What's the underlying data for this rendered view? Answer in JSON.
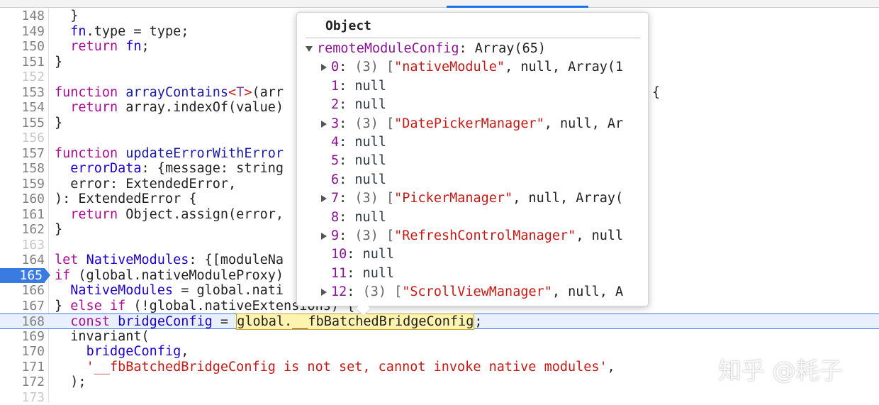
{
  "lines": [
    {
      "n": "148",
      "parts": [
        [
          "p",
          "  }"
        ]
      ]
    },
    {
      "n": "149",
      "parts": [
        [
          "p",
          "  "
        ],
        [
          "fn",
          "fn"
        ],
        [
          "p",
          ".type = type;"
        ]
      ]
    },
    {
      "n": "150",
      "parts": [
        [
          "p",
          "  "
        ],
        [
          "kw",
          "return"
        ],
        [
          "p",
          " "
        ],
        [
          "fn",
          "fn"
        ],
        [
          "p",
          ";"
        ]
      ]
    },
    {
      "n": "151",
      "parts": [
        [
          "p",
          "}"
        ]
      ]
    },
    {
      "n": "152",
      "dim": true,
      "parts": []
    },
    {
      "n": "153",
      "parts": [
        [
          "kw",
          "function"
        ],
        [
          "p",
          " "
        ],
        [
          "fn2",
          "arrayContains"
        ],
        [
          "str",
          "<"
        ],
        [
          "ty",
          "T"
        ],
        [
          "str",
          ">"
        ],
        [
          "p",
          "(arr"
        ]
      ],
      "tail": "{"
    },
    {
      "n": "154",
      "parts": [
        [
          "p",
          "  "
        ],
        [
          "kw",
          "return"
        ],
        [
          "p",
          " array.indexOf(value)"
        ]
      ]
    },
    {
      "n": "155",
      "parts": [
        [
          "p",
          "}"
        ]
      ]
    },
    {
      "n": "156",
      "dim": true,
      "parts": []
    },
    {
      "n": "157",
      "parts": [
        [
          "kw",
          "function"
        ],
        [
          "p",
          " "
        ],
        [
          "fn2",
          "updateErrorWithError"
        ]
      ]
    },
    {
      "n": "158",
      "parts": [
        [
          "p",
          "  "
        ],
        [
          "fn",
          "errorData"
        ],
        [
          "p",
          ": {message: string"
        ]
      ]
    },
    {
      "n": "159",
      "parts": [
        [
          "p",
          "  error: ExtendedError,"
        ]
      ]
    },
    {
      "n": "160",
      "parts": [
        [
          "p",
          "): ExtendedError {"
        ]
      ]
    },
    {
      "n": "161",
      "parts": [
        [
          "p",
          "  "
        ],
        [
          "kw",
          "return"
        ],
        [
          "p",
          " Object.assign(error,"
        ]
      ]
    },
    {
      "n": "162",
      "parts": [
        [
          "p",
          "}"
        ]
      ]
    },
    {
      "n": "163",
      "dim": true,
      "parts": []
    },
    {
      "n": "164",
      "parts": [
        [
          "kw",
          "let"
        ],
        [
          "p",
          " "
        ],
        [
          "fn",
          "NativeModules"
        ],
        [
          "p",
          ": {[moduleNa"
        ]
      ]
    },
    {
      "n": "165",
      "bp": true,
      "parts": [
        [
          "kw",
          "if"
        ],
        [
          "p",
          " (global.nativeModuleProxy)"
        ]
      ]
    },
    {
      "n": "166",
      "parts": [
        [
          "p",
          "  "
        ],
        [
          "fn",
          "NativeModules"
        ],
        [
          "p",
          " = global.nati"
        ]
      ]
    },
    {
      "n": "167",
      "parts": [
        [
          "p",
          "} "
        ],
        [
          "kw",
          "else"
        ],
        [
          "p",
          " "
        ],
        [
          "kw",
          "if"
        ],
        [
          "p",
          " (!global.nativeExtensions) {"
        ]
      ]
    },
    {
      "n": "168",
      "current": true,
      "parts": [
        [
          "p",
          "  "
        ],
        [
          "kw",
          "const"
        ],
        [
          "p",
          " "
        ],
        [
          "fn",
          "bridgeConfig"
        ],
        [
          "p",
          " = "
        ],
        [
          "hl",
          "global.__fbBatchedBridgeConfig"
        ],
        [
          "p",
          ";"
        ]
      ]
    },
    {
      "n": "169",
      "parts": [
        [
          "p",
          "  invariant("
        ]
      ]
    },
    {
      "n": "170",
      "parts": [
        [
          "p",
          "    "
        ],
        [
          "fn",
          "bridgeConfig"
        ],
        [
          "p",
          ","
        ]
      ]
    },
    {
      "n": "171",
      "parts": [
        [
          "p",
          "    "
        ],
        [
          "str",
          "'__fbBatchedBridgeConfig is not set, cannot invoke native modules'"
        ],
        [
          "p",
          ","
        ]
      ]
    },
    {
      "n": "172",
      "parts": [
        [
          "p",
          "  );"
        ]
      ]
    },
    {
      "n": "173",
      "dim": true,
      "parts": []
    }
  ],
  "popover": {
    "title": "Object",
    "root_key": "remoteModuleConfig",
    "root_value": "Array(65)",
    "items": [
      {
        "i": "0",
        "exp": true,
        "count": "(3)",
        "str": "\"nativeModule\"",
        "rest": ", null, Array(1"
      },
      {
        "i": "1",
        "value": "null"
      },
      {
        "i": "2",
        "value": "null"
      },
      {
        "i": "3",
        "exp": true,
        "count": "(3)",
        "str": "\"DatePickerManager\"",
        "rest": ", null, Ar"
      },
      {
        "i": "4",
        "value": "null"
      },
      {
        "i": "5",
        "value": "null"
      },
      {
        "i": "6",
        "value": "null"
      },
      {
        "i": "7",
        "exp": true,
        "count": "(3)",
        "str": "\"PickerManager\"",
        "rest": ", null, Array("
      },
      {
        "i": "8",
        "value": "null"
      },
      {
        "i": "9",
        "exp": true,
        "count": "(3)",
        "str": "\"RefreshControlManager\"",
        "rest": ", null"
      },
      {
        "i": "10",
        "value": "null"
      },
      {
        "i": "11",
        "value": "null"
      },
      {
        "i": "12",
        "exp": true,
        "count": "(3)",
        "str": "\"ScrollViewManager\"",
        "rest": ", null, A"
      }
    ]
  },
  "watermark": "知乎 @耗子",
  "colors": {
    "accent": "#3a7be2",
    "keyword": "#aa0d91",
    "string": "#c41a16"
  }
}
